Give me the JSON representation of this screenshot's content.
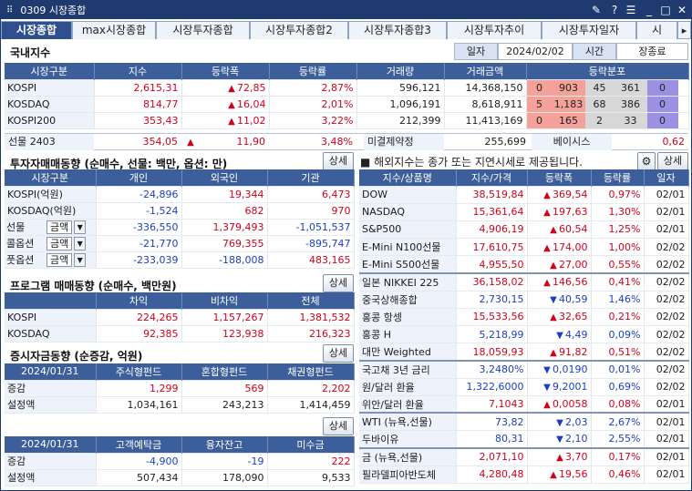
{
  "window": {
    "title": "0309 시장종합"
  },
  "tabs": [
    {
      "label": "시장종합",
      "active": true
    },
    {
      "label": "max시장종합"
    },
    {
      "label": "시장투자종합"
    },
    {
      "label": "시장투자종합2"
    },
    {
      "label": "시장투자종합3"
    },
    {
      "label": "시장투자추이"
    },
    {
      "label": "시장투자일자"
    },
    {
      "label": "시"
    }
  ],
  "domestic": {
    "title": "국내지수",
    "date_label": "일자",
    "date": "2024/02/02",
    "time_label": "시간",
    "time": "장종료",
    "headers": [
      "시장구분",
      "지수",
      "등락폭",
      "등락률",
      "거래량",
      "거래금액",
      "등락분포"
    ],
    "rows": [
      {
        "name": "KOSPI",
        "index": "2,615,31",
        "change": "72,85",
        "rate": "2,87%",
        "volume": "596,121",
        "amount": "14,368,150",
        "dist": [
          "0",
          "903",
          "45",
          "361",
          "0"
        ]
      },
      {
        "name": "KOSDAQ",
        "index": "814,77",
        "change": "16,04",
        "rate": "2,01%",
        "volume": "1,096,191",
        "amount": "8,618,911",
        "dist": [
          "5",
          "1,183",
          "68",
          "386",
          "0"
        ]
      },
      {
        "name": "KOSPI200",
        "index": "353,43",
        "change": "11,02",
        "rate": "3,22%",
        "volume": "212,399",
        "amount": "11,413,169",
        "dist": [
          "0",
          "165",
          "2",
          "33",
          "0"
        ]
      }
    ],
    "futures": {
      "name": "선물 2403",
      "index": "354,05",
      "change": "11,90",
      "rate": "3,48%",
      "oi_label": "미결제약정",
      "oi": "255,699",
      "basis_label": "베이시스",
      "basis": "0,62"
    }
  },
  "investor": {
    "title": "투자자매매동향 (순매수, 선물: 백만, 옵션: 만)",
    "detail": "상세",
    "headers": [
      "시장구분",
      "개인",
      "외국인",
      "기관"
    ],
    "rows": [
      {
        "name": "KOSPI(억원)",
        "v": [
          "-24,896",
          "19,344",
          "6,473"
        ],
        "c": [
          "blue",
          "red",
          "red"
        ]
      },
      {
        "name": "KOSDAQ(억원)",
        "v": [
          "-1,524",
          "682",
          "970"
        ],
        "c": [
          "blue",
          "red",
          "red"
        ]
      },
      {
        "name": "선물",
        "sel": "금액",
        "v": [
          "-336,550",
          "1,379,493",
          "-1,051,537"
        ],
        "c": [
          "blue",
          "red",
          "blue"
        ]
      },
      {
        "name": "콜옵션",
        "sel": "금액",
        "v": [
          "-21,770",
          "769,355",
          "-895,747"
        ],
        "c": [
          "blue",
          "red",
          "blue"
        ]
      },
      {
        "name": "풋옵션",
        "sel": "금액",
        "v": [
          "-233,039",
          "-188,008",
          "483,165"
        ],
        "c": [
          "blue",
          "blue",
          "red"
        ]
      }
    ]
  },
  "program": {
    "title": "프로그램 매매동향 (순매수, 백만원)",
    "detail": "상세",
    "headers": [
      "",
      "차익",
      "비차익",
      "전체"
    ],
    "rows": [
      {
        "name": "KOSPI",
        "v": [
          "224,265",
          "1,157,267",
          "1,381,532"
        ]
      },
      {
        "name": "KOSDAQ",
        "v": [
          "92,385",
          "123,938",
          "216,323"
        ]
      }
    ]
  },
  "fund": {
    "title": "증시자금동향 (순증감, 억원)",
    "detail": "상세",
    "headers": [
      "2024/01/31",
      "주식형펀드",
      "혼합형펀드",
      "채권형펀드"
    ],
    "rows": [
      {
        "name": "증감",
        "v": [
          "1,299",
          "569",
          "2,202"
        ],
        "c": [
          "red",
          "red",
          "red"
        ]
      },
      {
        "name": "설정액",
        "v": [
          "1,034,161",
          "243,213",
          "1,414,459"
        ],
        "c": [
          "",
          "",
          ""
        ]
      }
    ]
  },
  "deposit": {
    "detail": "상세",
    "headers": [
      "2024/01/31",
      "고객예탁금",
      "융자잔고",
      "미수금"
    ],
    "rows": [
      {
        "name": "증감",
        "v": [
          "-4,900",
          "-19",
          "222"
        ],
        "c": [
          "blue",
          "blue",
          "red"
        ]
      },
      {
        "name": "설정액",
        "v": [
          "507,434",
          "178,090",
          "9,533"
        ],
        "c": [
          "",
          "",
          ""
        ]
      }
    ]
  },
  "overseas": {
    "notice": "■ 해외지수는 종가 또는 지연시세로 제공됩니다.",
    "detail": "상세",
    "headers": [
      "지수/상품명",
      "지수/가격",
      "등락폭",
      "등락률",
      "일자"
    ],
    "rows": [
      {
        "name": "DOW",
        "price": "38,519,84",
        "dir": "up",
        "change": "369,54",
        "rate": "0,97%",
        "date": "02/01",
        "g": 0
      },
      {
        "name": "NASDAQ",
        "price": "15,361,64",
        "dir": "up",
        "change": "197,63",
        "rate": "1,30%",
        "date": "02/01",
        "g": 0
      },
      {
        "name": "S&P500",
        "price": "4,906,19",
        "dir": "up",
        "change": "60,54",
        "rate": "1,25%",
        "date": "02/01",
        "g": 0
      },
      {
        "name": "E-Mini N100선물",
        "price": "17,610,75",
        "dir": "up",
        "change": "174,00",
        "rate": "1,00%",
        "date": "02/02",
        "g": 0
      },
      {
        "name": "E-Mini S500선물",
        "price": "4,955,50",
        "dir": "up",
        "change": "27,00",
        "rate": "0,55%",
        "date": "02/02",
        "g": 0
      },
      {
        "name": "일본 NIKKEI 225",
        "price": "36,158,02",
        "dir": "up",
        "change": "146,56",
        "rate": "0,41%",
        "date": "02/02",
        "g": 1
      },
      {
        "name": "중국상해종합",
        "price": "2,730,15",
        "dir": "dn",
        "change": "40,59",
        "rate": "1,46%",
        "date": "02/02",
        "g": 1
      },
      {
        "name": "홍콩 항셍",
        "price": "15,533,56",
        "dir": "up",
        "change": "32,65",
        "rate": "0,21%",
        "date": "02/02",
        "g": 1
      },
      {
        "name": "홍콩 H",
        "price": "5,218,99",
        "dir": "dn",
        "change": "4,49",
        "rate": "0,09%",
        "date": "02/02",
        "g": 1
      },
      {
        "name": "대만 Weighted",
        "price": "18,059,93",
        "dir": "up",
        "change": "91,82",
        "rate": "0,51%",
        "date": "02/02",
        "g": 1
      },
      {
        "name": "국고채 3년 금리",
        "price": "3,2480%",
        "dir": "dn",
        "change": "0,0190",
        "rate": "0,01%",
        "date": "02/02",
        "g": 2
      },
      {
        "name": "원/달러 환율",
        "price": "1,322,6000",
        "dir": "dn",
        "change": "9,2001",
        "rate": "0,69%",
        "date": "02/02",
        "g": 2
      },
      {
        "name": "위안/달러 환율",
        "price": "7,1043",
        "dir": "up",
        "change": "0,0058",
        "rate": "0,08%",
        "date": "02/01",
        "g": 2
      },
      {
        "name": "WTI (뉴욕,선물)",
        "price": "73,82",
        "dir": "dn",
        "change": "2,03",
        "rate": "2,67%",
        "date": "02/01",
        "g": 3
      },
      {
        "name": "두바이유",
        "price": "80,31",
        "dir": "dn",
        "change": "2,10",
        "rate": "2,55%",
        "date": "02/01",
        "g": 3
      },
      {
        "name": "금 (뉴욕,선물)",
        "price": "2,071,10",
        "dir": "up",
        "change": "3,70",
        "rate": "0,17%",
        "date": "02/01",
        "g": 4
      },
      {
        "name": "필라델피아반도체",
        "price": "4,280,48",
        "dir": "up",
        "change": "19,56",
        "rate": "0,46%",
        "date": "02/01",
        "g": 4
      }
    ]
  },
  "colors": {
    "header": "#3c5f9b",
    "title_bar": "#1f3a6e",
    "up": "#d0021b",
    "down": "#1a3fc4",
    "dist_up": "#f4a19a",
    "dist_flat": "#d7d7d7",
    "dist_down": "#9b90e2"
  }
}
